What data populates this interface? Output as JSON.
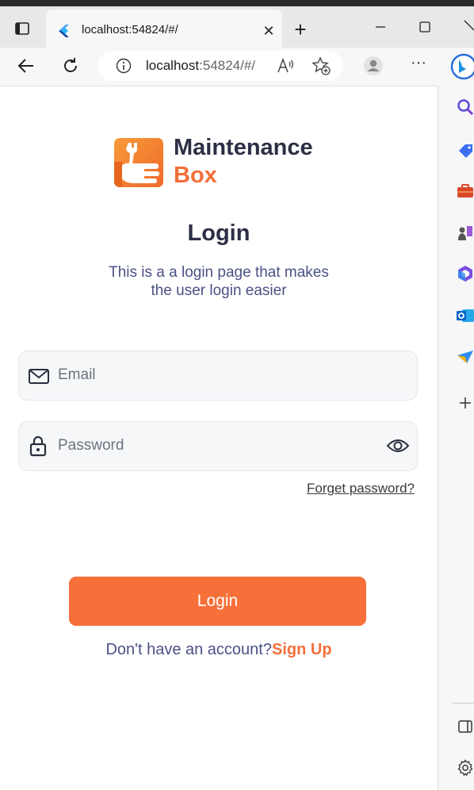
{
  "browser": {
    "tab_title": "localhost:54824/#/",
    "tab_close": "✕",
    "new_tab": "+",
    "url_host": "localhost",
    "url_path": ":54824/#/",
    "more_menu": "···"
  },
  "brand": {
    "line1": "Maintenance",
    "line2": "Box"
  },
  "login": {
    "title": "Login",
    "subtitle": "This is a a login page that makes the user login easier",
    "email_placeholder": "Email",
    "password_placeholder": "Password",
    "forget_password": "Forget password?",
    "login_button": "Login",
    "no_account_text": "Don't have an account?",
    "sign_up": "Sign Up"
  },
  "colors": {
    "accent": "#f7703a",
    "heading": "#2d2f45",
    "subtext": "#4b5185",
    "field_bg": "#f6f7f9"
  }
}
